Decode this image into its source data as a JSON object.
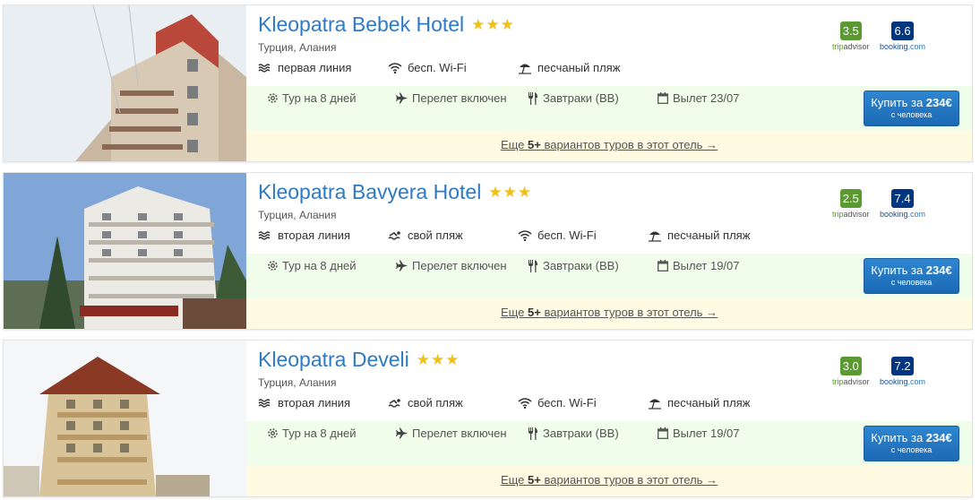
{
  "hotels": [
    {
      "name": "Kleopatra Bebek Hotel",
      "stars": 3,
      "location": "Турция, Алания",
      "features": [
        {
          "icon": "sea-line-icon",
          "label": "первая линия"
        },
        {
          "icon": "wifi-icon",
          "label": "бесп. Wi-Fi"
        },
        {
          "icon": "beach-umbrella-icon",
          "label": "песчаный пляж"
        }
      ],
      "ratings": {
        "tripadvisor": {
          "score": "3.5",
          "brand_a": "trip",
          "brand_b": "advisor"
        },
        "booking": {
          "score": "6.6",
          "brand_a": "booking",
          "brand_b": ".com"
        }
      },
      "offer": {
        "tour": "Тур на 8 дней",
        "flight": "Перелет включен",
        "meal": "Завтраки (BB)",
        "departure": "Вылет 23/07"
      },
      "buy": {
        "prefix": "Купить за ",
        "price": "234€",
        "sub": "с человека"
      },
      "more": {
        "prefix": "Еще ",
        "count": "5+",
        "suffix": " вариантов туров в этот отель →"
      }
    },
    {
      "name": "Kleopatra Bavyera Hotel",
      "stars": 3,
      "location": "Турция, Алания",
      "features": [
        {
          "icon": "sea-line-icon",
          "label": "вторая линия"
        },
        {
          "icon": "swimmer-icon",
          "label": "свой пляж"
        },
        {
          "icon": "wifi-icon",
          "label": "бесп. Wi-Fi"
        },
        {
          "icon": "beach-umbrella-icon",
          "label": "песчаный пляж"
        }
      ],
      "ratings": {
        "tripadvisor": {
          "score": "2.5",
          "brand_a": "trip",
          "brand_b": "advisor"
        },
        "booking": {
          "score": "7.4",
          "brand_a": "booking",
          "brand_b": ".com"
        }
      },
      "offer": {
        "tour": "Тур на 8 дней",
        "flight": "Перелет включен",
        "meal": "Завтраки (BB)",
        "departure": "Вылет 19/07"
      },
      "buy": {
        "prefix": "Купить за ",
        "price": "234€",
        "sub": "с человека"
      },
      "more": {
        "prefix": "Еще ",
        "count": "5+",
        "suffix": " вариантов туров в этот отель →"
      }
    },
    {
      "name": "Kleopatra Develi",
      "stars": 3,
      "location": "Турция, Алания",
      "features": [
        {
          "icon": "sea-line-icon",
          "label": "вторая линия"
        },
        {
          "icon": "swimmer-icon",
          "label": "свой пляж"
        },
        {
          "icon": "wifi-icon",
          "label": "бесп. Wi-Fi"
        },
        {
          "icon": "beach-umbrella-icon",
          "label": "песчаный пляж"
        }
      ],
      "ratings": {
        "tripadvisor": {
          "score": "3.0",
          "brand_a": "trip",
          "brand_b": "advisor"
        },
        "booking": {
          "score": "7.2",
          "brand_a": "booking",
          "brand_b": ".com"
        }
      },
      "offer": {
        "tour": "Тур на 8 дней",
        "flight": "Перелет включен",
        "meal": "Завтраки (BB)",
        "departure": "Вылет 19/07"
      },
      "buy": {
        "prefix": "Купить за ",
        "price": "234€",
        "sub": "с человека"
      },
      "more": {
        "prefix": "Еще ",
        "count": "5+",
        "suffix": " вариантов туров в этот отель →"
      }
    }
  ],
  "colors": {
    "link": "#2d7ac6",
    "star": "#f0bf1a",
    "tripadvisor": "#5b9a30",
    "booking": "#003580",
    "offer_bg": "#f0fdea",
    "more_bg": "#fffbe3",
    "button": "#1b69b4"
  }
}
